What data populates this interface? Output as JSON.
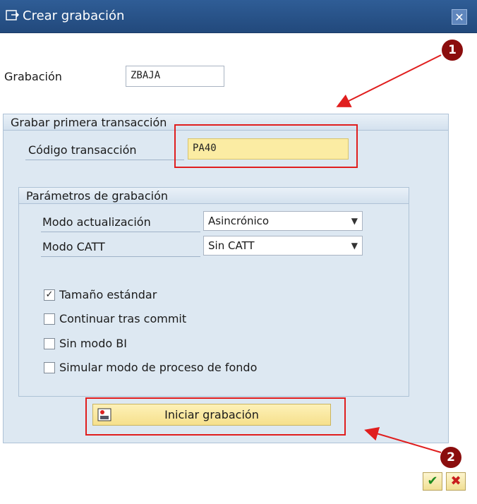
{
  "window": {
    "title": "Crear grabación"
  },
  "recording": {
    "label": "Grabación",
    "value": "ZBAJA"
  },
  "group1": {
    "title": "Grabar primera transacción",
    "tcode_label": "Código transacción",
    "tcode_value": "PA40"
  },
  "params": {
    "title": "Parámetros de grabación",
    "update_mode_label": "Modo actualización",
    "update_mode_value": "Asincrónico",
    "catt_mode_label": "Modo CATT",
    "catt_mode_value": "Sin CATT",
    "checkboxes": [
      {
        "label": "Tamaño estándar",
        "checked": true
      },
      {
        "label": "Continuar tras commit",
        "checked": false
      },
      {
        "label": "Sin modo BI",
        "checked": false
      },
      {
        "label": "Simular modo de proceso de fondo",
        "checked": false
      }
    ]
  },
  "start_button": {
    "label": "Iniciar grabación"
  },
  "annotations": {
    "badge1": "1",
    "badge2": "2",
    "highlight_color": "#e01e1e"
  },
  "icons": {
    "title_icon": "window-icon",
    "close": "close-icon",
    "ok": "checkmark-icon",
    "cancel": "cancel-icon",
    "record": "record-icon"
  }
}
